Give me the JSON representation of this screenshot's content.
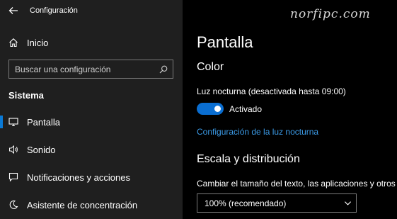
{
  "window": {
    "title": "Configuración",
    "back_icon": "back-arrow-icon"
  },
  "sidebar": {
    "home": {
      "label": "Inicio",
      "icon": "home-icon"
    },
    "search": {
      "placeholder": "Buscar una configuración",
      "value": "",
      "icon": "search-icon"
    },
    "section_title": "Sistema",
    "items": [
      {
        "label": "Pantalla",
        "icon": "monitor-icon",
        "active": true
      },
      {
        "label": "Sonido",
        "icon": "speaker-icon",
        "active": false
      },
      {
        "label": "Notificaciones y acciones",
        "icon": "notification-icon",
        "active": false
      },
      {
        "label": "Asistente de concentración",
        "icon": "moon-icon",
        "active": false
      }
    ]
  },
  "watermark": "norfipc.com",
  "main": {
    "page_title": "Pantalla",
    "color_heading": "Color",
    "night_light_status": "Luz nocturna (desactivada hasta 09:00)",
    "toggle": {
      "state": "on",
      "label": "Activado"
    },
    "night_light_link": "Configuración de la luz nocturna",
    "scale_heading": "Escala y distribución",
    "scale_description": "Cambiar el tamaño del texto, las aplicaciones y otros",
    "scale_select": {
      "value": "100% (recomendado)"
    }
  },
  "colors": {
    "accent": "#0a6ed1",
    "link": "#3b9ae6",
    "sidebar_bg": "#1f1f1f",
    "main_bg": "#000000"
  }
}
